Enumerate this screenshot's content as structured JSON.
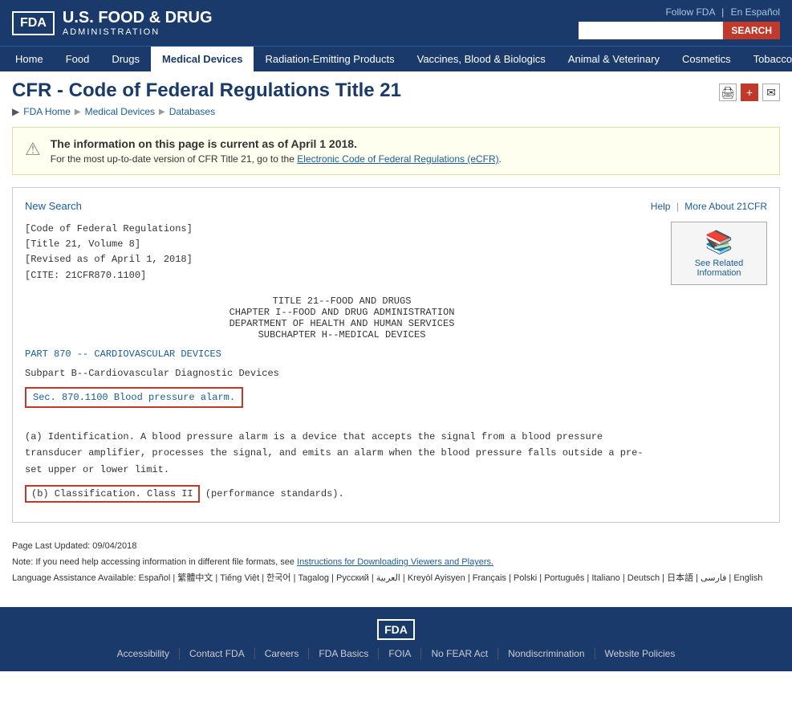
{
  "header": {
    "logo_text": "FDA",
    "title_main": "U.S. FOOD & DRUG",
    "title_sub": "ADMINISTRATION",
    "follow_fda": "Follow FDA",
    "en_espanol": "En Español",
    "search_placeholder": "",
    "search_button": "SEARCH"
  },
  "nav": {
    "items": [
      {
        "label": "Home",
        "active": false
      },
      {
        "label": "Food",
        "active": false
      },
      {
        "label": "Drugs",
        "active": false
      },
      {
        "label": "Medical Devices",
        "active": true
      },
      {
        "label": "Radiation-Emitting Products",
        "active": false
      },
      {
        "label": "Vaccines, Blood & Biologics",
        "active": false
      },
      {
        "label": "Animal & Veterinary",
        "active": false
      },
      {
        "label": "Cosmetics",
        "active": false
      },
      {
        "label": "Tobacco Products",
        "active": false
      }
    ]
  },
  "page": {
    "title": "CFR - Code of Federal Regulations Title 21",
    "breadcrumb": [
      "FDA Home",
      "Medical Devices",
      "Databases"
    ],
    "warning_title": "The information on this page is current as of April 1 2018.",
    "warning_body": "For the most up-to-date version of CFR Title 21, go to the Electronic Code of Federal Regulations (eCFR).",
    "ecfr_link": "Electronic Code of Federal Regulations (eCFR)"
  },
  "toolbar": {
    "new_search": "New Search",
    "help": "Help",
    "more_about": "More About 21CFR"
  },
  "cfr": {
    "meta_line1": "[Code of Federal Regulations]",
    "meta_line2": "[Title 21, Volume 8]",
    "meta_line3": "[Revised as of April 1, 2018]",
    "meta_line4": "[CITE: 21CFR870.1100]",
    "title_line1": "TITLE 21--FOOD AND DRUGS",
    "title_line2": "CHAPTER I--FOOD AND DRUG ADMINISTRATION",
    "title_line3": "DEPARTMENT OF HEALTH AND HUMAN SERVICES",
    "title_line4": "SUBCHAPTER H--MEDICAL DEVICES",
    "part_label": "PART 870 -- CARDIOVASCULAR DEVICES",
    "subpart": "Subpart B--Cardiovascular Diagnostic Devices",
    "section": "Sec. 870.1100  Blood pressure alarm.",
    "body_text": "(a) Identification. A blood pressure alarm is a device that accepts the signal from a blood pressure transducer amplifier, processes the signal, and emits an alarm when the blood pressure falls outside a pre-set upper or lower limit.",
    "classification_start": "(b) Classification. Class II",
    "classification_end": "(performance standards)."
  },
  "related": {
    "icon": "📚",
    "label": "See Related Information"
  },
  "footer_info": {
    "last_updated": "Page Last Updated: 09/04/2018",
    "note": "Note: If you need help accessing information in different file formats, see",
    "note_link": "Instructions for Downloading Viewers and Players.",
    "language": "Language Assistance Available:",
    "languages": "Español | 繁體中文 | Tiếng Việt | 한국어 | Tagalog | Русский | العربية | Kreyòl Ayisyen | Français | Polski | Português | Italiano | Deutsch | 日本語 | فارسی | English"
  },
  "footer": {
    "links": [
      "Accessibility",
      "Contact FDA",
      "Careers",
      "FDA Basics",
      "FOIA",
      "No FEAR Act",
      "Nondiscrimination",
      "Website Policies"
    ]
  }
}
